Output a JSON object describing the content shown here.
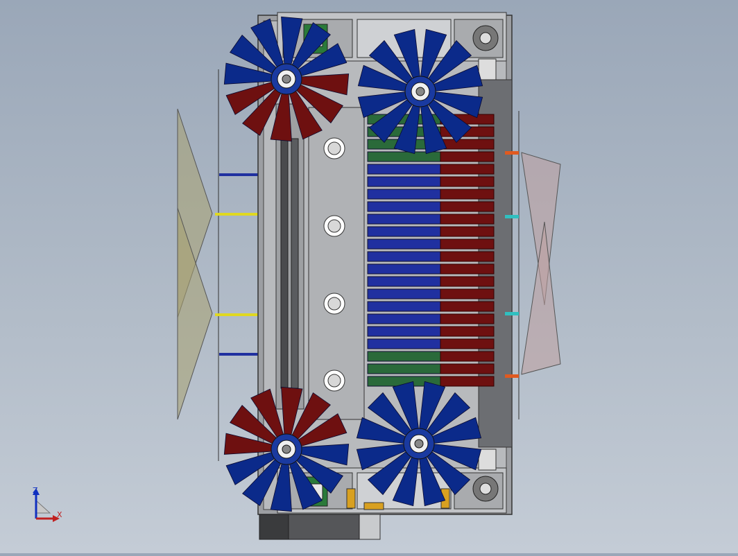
{
  "triad": {
    "z_label": "Z",
    "x_label": "X"
  },
  "colors": {
    "background_top": "#9aa7b8",
    "background_bottom": "#c4ccd6",
    "blade_blue": "#0b2a8a",
    "blade_red": "#6e1010",
    "frame_gray": "#8a8c8f",
    "panel_light": "#c8c9cb",
    "bar_blue": "#2030a0",
    "bar_yellow": "#e0d820",
    "accent_green": "#2a7a3a",
    "accent_orange": "#e05a20",
    "accent_cyan": "#30c0c0",
    "triad_z": "#1030c0",
    "triad_x": "#c02020"
  },
  "components": [
    "fan-rotor-top-left",
    "fan-rotor-top-right",
    "fan-rotor-bottom-left",
    "fan-rotor-bottom-right",
    "center-plate",
    "blade-rack",
    "left-mesh-panel",
    "right-mesh-panel",
    "bearing-housing-top",
    "bearing-housing-bottom",
    "motor-block"
  ]
}
